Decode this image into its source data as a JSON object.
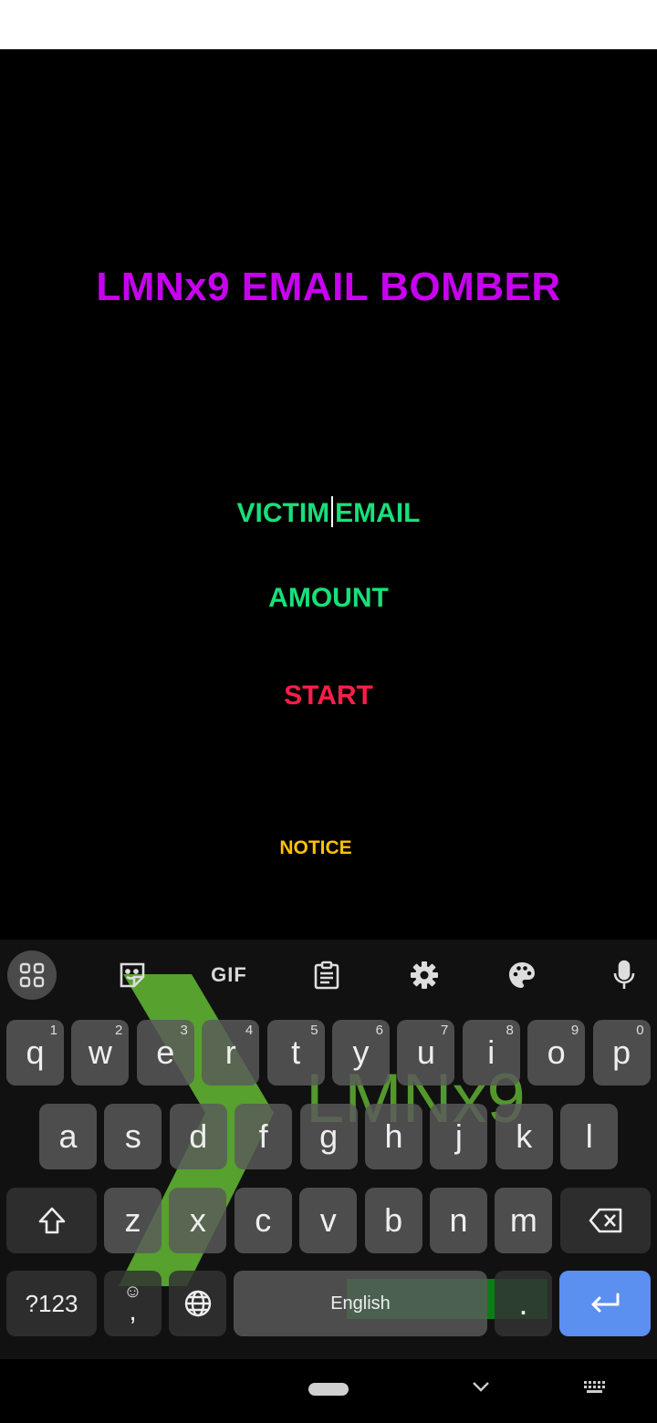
{
  "app": {
    "title": "LMNx9 EMAIL BOMBER",
    "email_field": {
      "before_caret": "VICTIM",
      "after_caret": "EMAIL"
    },
    "amount_field": "AMOUNT",
    "start_button": "START",
    "notice": "NOTICE"
  },
  "colors": {
    "title": "#c800f0",
    "fields": "#18e07a",
    "start": "#ff1e4a",
    "notice": "#ffc20a",
    "enter_key": "#5b8ff0",
    "keyboard_logo": "#6fd13a"
  },
  "keyboard": {
    "background_logo": "LMNx9",
    "toolbar": {
      "apps": "apps-grid-icon",
      "sticker": "sticker-icon",
      "gif_label": "GIF",
      "clipboard": "clipboard-icon",
      "settings": "gear-icon",
      "theme": "palette-icon",
      "voice": "microphone-icon"
    },
    "row1": [
      {
        "key": "q",
        "hint": "1"
      },
      {
        "key": "w",
        "hint": "2"
      },
      {
        "key": "e",
        "hint": "3"
      },
      {
        "key": "r",
        "hint": "4"
      },
      {
        "key": "t",
        "hint": "5"
      },
      {
        "key": "y",
        "hint": "6"
      },
      {
        "key": "u",
        "hint": "7"
      },
      {
        "key": "i",
        "hint": "8"
      },
      {
        "key": "o",
        "hint": "9"
      },
      {
        "key": "p",
        "hint": "0"
      }
    ],
    "row2": [
      "a",
      "s",
      "d",
      "f",
      "g",
      "h",
      "j",
      "k",
      "l"
    ],
    "row3": [
      "z",
      "x",
      "c",
      "v",
      "b",
      "n",
      "m"
    ],
    "symbols_label": "?123",
    "comma": ",",
    "space_label": "English",
    "period": "."
  },
  "nav": {
    "home": "home-pill",
    "back": "chevron-down-icon",
    "keyboard_switch": "keyboard-icon"
  }
}
